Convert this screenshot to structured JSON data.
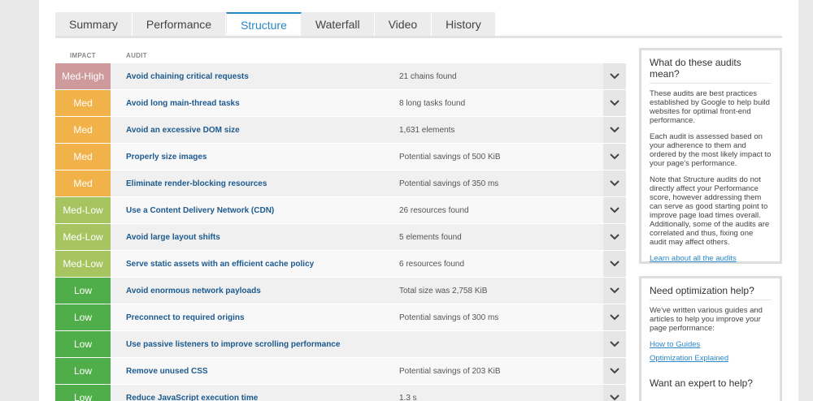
{
  "tabs": [
    "Summary",
    "Performance",
    "Structure",
    "Waterfall",
    "Video",
    "History"
  ],
  "active_tab": "Structure",
  "headers": {
    "impact": "IMPACT",
    "audit": "AUDIT"
  },
  "colors": {
    "med_high": "#cf9a9b",
    "med": "#f2b24a",
    "med_low": "#a6c45f",
    "low": "#4fae49",
    "accent": "#2a87c8"
  },
  "audits": [
    {
      "impact": "Med-High",
      "level": "med_high",
      "title": "Avoid chaining critical requests",
      "result": "21 chains found"
    },
    {
      "impact": "Med",
      "level": "med",
      "title": "Avoid long main-thread tasks",
      "result": "8 long tasks found"
    },
    {
      "impact": "Med",
      "level": "med",
      "title": "Avoid an excessive DOM size",
      "result": "1,631 elements"
    },
    {
      "impact": "Med",
      "level": "med",
      "title": "Properly size images",
      "result": "Potential savings of 500 KiB"
    },
    {
      "impact": "Med",
      "level": "med",
      "title": "Eliminate render-blocking resources",
      "result": "Potential savings of 350 ms"
    },
    {
      "impact": "Med-Low",
      "level": "med_low",
      "title": "Use a Content Delivery Network (CDN)",
      "result": "26 resources found"
    },
    {
      "impact": "Med-Low",
      "level": "med_low",
      "title": "Avoid large layout shifts",
      "result": "5 elements found"
    },
    {
      "impact": "Med-Low",
      "level": "med_low",
      "title": "Serve static assets with an efficient cache policy",
      "result": "6 resources found"
    },
    {
      "impact": "Low",
      "level": "low",
      "title": "Avoid enormous network payloads",
      "result": "Total size was 2,758 KiB"
    },
    {
      "impact": "Low",
      "level": "low",
      "title": "Preconnect to required origins",
      "result": "Potential savings of 300 ms"
    },
    {
      "impact": "Low",
      "level": "low",
      "title": "Use passive listeners to improve scrolling performance",
      "result": ""
    },
    {
      "impact": "Low",
      "level": "low",
      "title": "Remove unused CSS",
      "result": "Potential savings of 203 KiB"
    },
    {
      "impact": "Low",
      "level": "low",
      "title": "Reduce JavaScript execution time",
      "result": "1.3 s"
    }
  ],
  "sidebar": {
    "audits_panel": {
      "title": "What do these audits mean?",
      "p1": "These audits are best practices established by Google to help build websites for optimal front-end performance.",
      "p2": "Each audit is assessed based on your adherence to them and ordered by the most likely impact to your page's performance.",
      "p3": "Note that Structure audits do not directly affect your Performance score, however addressing them can serve as good starting point to improve page load times overall. Additionally, some of the audits are correlated and thus, fixing one audit may affect others.",
      "link": "Learn about all the audits"
    },
    "help_panel": {
      "title": "Need optimization help?",
      "p1": "We've written various guides and articles to help you improve your page performance:",
      "link1": "How to Guides",
      "link2": "Optimization Explained",
      "title2": "Want an expert to help?"
    }
  }
}
